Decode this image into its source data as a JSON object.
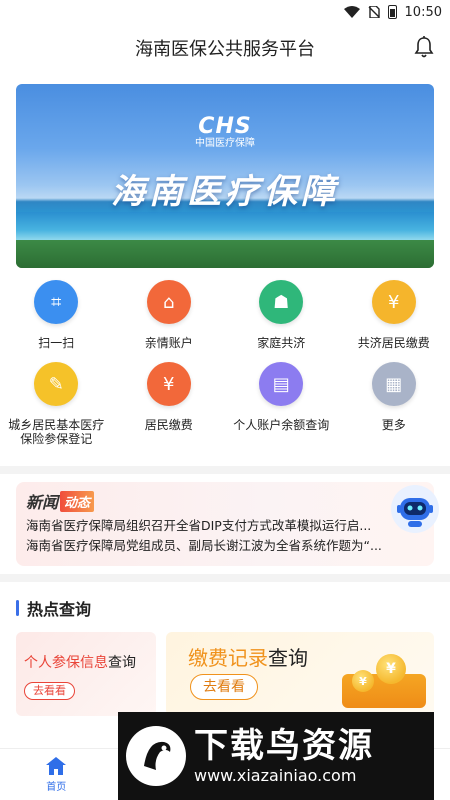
{
  "status_bar": {
    "time": "10:50"
  },
  "header": {
    "title": "海南医保公共服务平台"
  },
  "banner": {
    "logo": "CHS",
    "logo_sub": "中国医疗保障",
    "headline": "海南医疗保障"
  },
  "services": [
    {
      "label": "扫一扫",
      "icon": "scan-icon",
      "color": "#3b8ff0",
      "glyph": "⌗"
    },
    {
      "label": "亲情账户",
      "icon": "family-account-icon",
      "color": "#f2683a",
      "glyph": "⌂"
    },
    {
      "label": "家庭共济",
      "icon": "family-mutual-icon",
      "color": "#2fb77a",
      "glyph": "☗"
    },
    {
      "label": "共济居民缴费",
      "icon": "mutual-payment-icon",
      "color": "#f5b52c",
      "glyph": "¥"
    },
    {
      "label": "城乡居民基本医疗保险参保登记",
      "icon": "registration-icon",
      "color": "#f5c229",
      "glyph": "✎"
    },
    {
      "label": "居民缴费",
      "icon": "resident-payment-icon",
      "color": "#f2683a",
      "glyph": "¥"
    },
    {
      "label": "个人账户余额查询",
      "icon": "balance-query-icon",
      "color": "#8c7cf0",
      "glyph": "▤"
    },
    {
      "label": "更多",
      "icon": "more-icon",
      "color": "#a9b3c8",
      "glyph": "▦"
    }
  ],
  "news": {
    "tag_a": "新闻",
    "tag_b": "动态",
    "items": [
      "海南省医疗保障局组织召开全省DIP支付方式改革模拟运行启...",
      "海南省医疗保障局党组成员、副局长谢江波为全省系统作题为“..."
    ]
  },
  "hot": {
    "title": "热点查询",
    "cards": [
      {
        "highlight": "个人参保信息",
        "rest": "查询",
        "button": "去看看"
      },
      {
        "highlight": "缴费记录",
        "rest": "查询",
        "button": "去看看"
      }
    ]
  },
  "tabbar": {
    "home": "首页"
  },
  "watermark": {
    "title": "下载鸟资源",
    "url": "www.xiazainiao.com"
  },
  "colors": {
    "accent": "#2f6ee8",
    "news_tag": "#f04d3c"
  }
}
